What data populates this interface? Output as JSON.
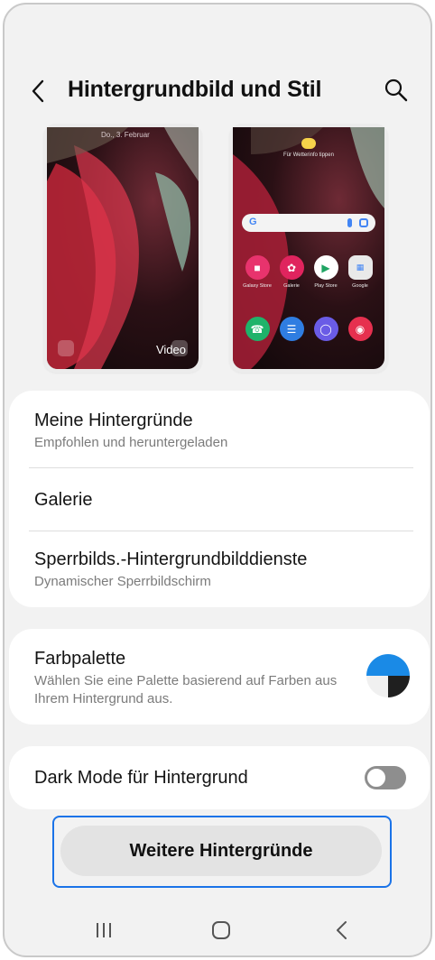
{
  "header": {
    "title": "Hintergrundbild und Stil",
    "back_icon": "chevron-left-icon",
    "search_icon": "search-icon"
  },
  "previews": {
    "lock": {
      "date": "Do., 3. Februar",
      "media_label": "Video"
    },
    "home": {
      "weather_text": "Für Wetterinfo tippen",
      "apps_row1": [
        "Galaxy Store",
        "Galerie",
        "Play Store",
        "Google"
      ],
      "apps_row2": [
        "",
        "",
        "",
        ""
      ]
    }
  },
  "wallpaper_list": {
    "items": [
      {
        "title": "Meine Hintergründe",
        "subtitle": "Empfohlen und heruntergeladen"
      },
      {
        "title": "Galerie",
        "subtitle": ""
      },
      {
        "title": "Sperrbilds.-Hintergrundbilddienste",
        "subtitle": "Dynamischer Sperrbildschirm"
      }
    ]
  },
  "palette": {
    "title": "Farbpalette",
    "subtitle": "Wählen Sie eine Palette basierend auf Farben aus Ihrem Hintergrund aus.",
    "colors": [
      "#1a8ae6",
      "#f0f0f0",
      "#1f1f1f"
    ]
  },
  "dark_mode": {
    "label": "Dark Mode für Hintergrund",
    "enabled": false
  },
  "more_button": {
    "label": "Weitere Hintergründe"
  },
  "navbar": {
    "recents_icon": "recents-icon",
    "home_icon": "home-icon",
    "back_icon": "back-icon"
  },
  "colors": {
    "background": "#f2f2f2",
    "card": "#ffffff",
    "accent": "#1a73e8",
    "toggle_off": "#8e8e8e"
  }
}
